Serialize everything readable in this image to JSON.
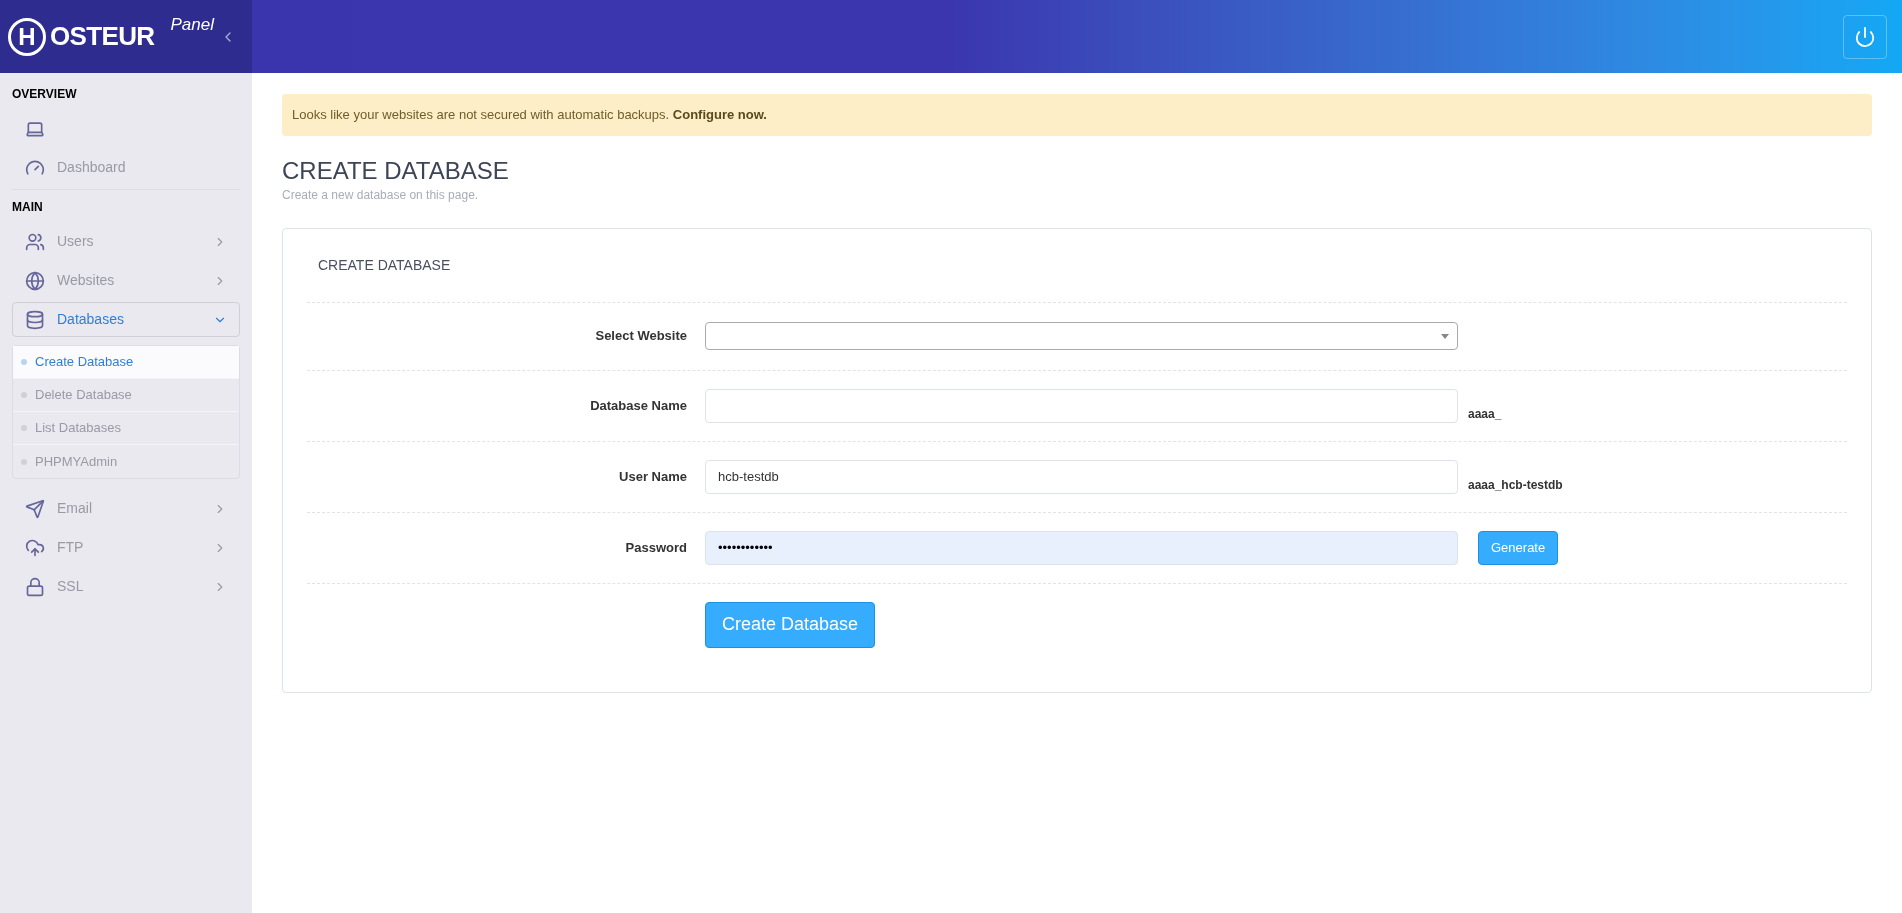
{
  "logo": {
    "mark": "H",
    "text": "OSTEUR",
    "subtitle": "Panel"
  },
  "sidebar": {
    "sections": [
      {
        "title": "OVERVIEW",
        "items": [
          {
            "kind": "link",
            "selected": false
          },
          {
            "kind": "link",
            "label": "Dashboard",
            "selected": false
          }
        ]
      },
      {
        "title": "MAIN",
        "items": [
          {
            "kind": "menu",
            "label": "Users",
            "expanded": false,
            "selected": false
          },
          {
            "kind": "menu",
            "label": "Websites",
            "expanded": false,
            "selected": false
          },
          {
            "kind": "menu",
            "label": "Databases",
            "expanded": true,
            "selected": true,
            "children": [
              {
                "label": "Create Database",
                "selected": true
              },
              {
                "label": "Delete Database",
                "selected": false
              },
              {
                "label": "List Databases",
                "selected": false
              },
              {
                "label": "PHPMYAdmin",
                "selected": false
              }
            ]
          },
          {
            "kind": "menu",
            "label": "Email",
            "expanded": false,
            "selected": false
          },
          {
            "kind": "menu",
            "label": "FTP",
            "expanded": false,
            "selected": false
          },
          {
            "kind": "menu",
            "label": "SSL",
            "expanded": false,
            "selected": false
          }
        ]
      }
    ]
  },
  "alert": {
    "text": "Looks like your websites are not secured with automatic backups.",
    "link": "Configure now."
  },
  "page": {
    "title": "CREATE DATABASE",
    "subtitle": "Create a new database on this page."
  },
  "card": {
    "title": "CREATE DATABASE",
    "fields": [
      {
        "kind": "select",
        "label": "Select Website"
      },
      {
        "kind": "text",
        "label": "Database Name",
        "suffix": "aaaa_"
      },
      {
        "kind": "text",
        "label": "User Name",
        "value": "hcb-testdb",
        "suffix": "aaaa_hcb-testdb"
      },
      {
        "kind": "password",
        "label": "Password",
        "value": "••••••••••••",
        "button": "Generate"
      }
    ],
    "submit": "Create Database"
  }
}
